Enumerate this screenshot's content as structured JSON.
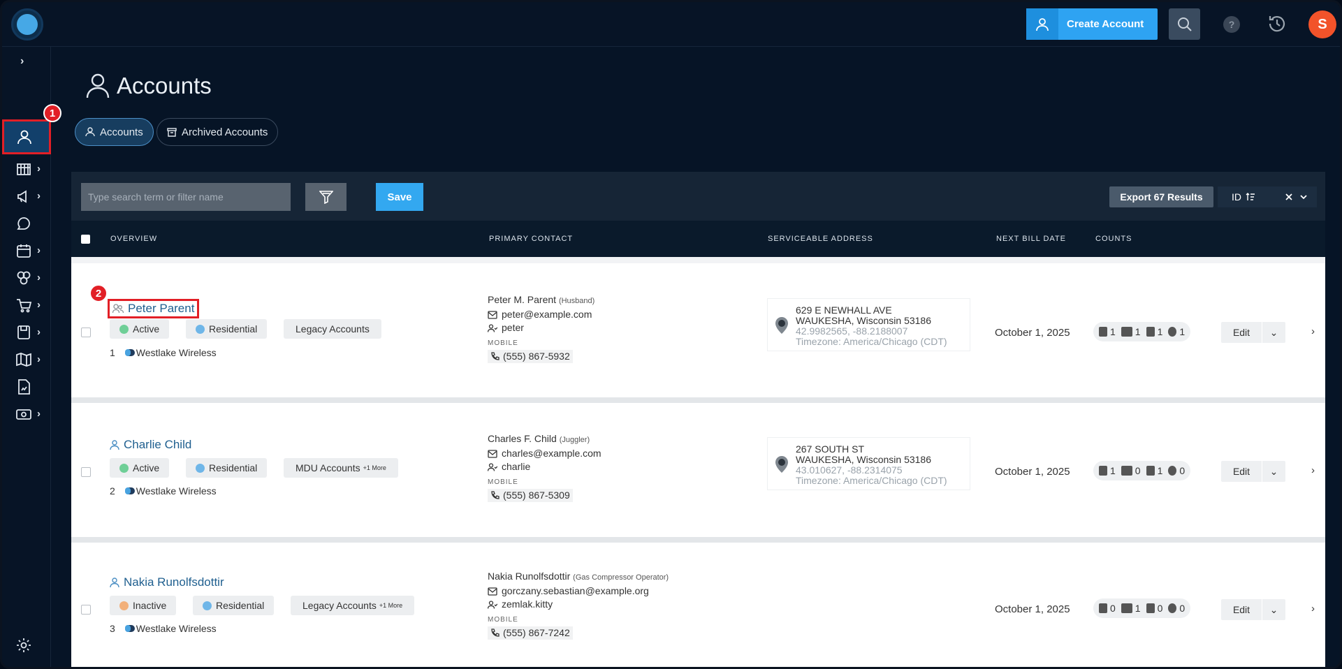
{
  "header": {
    "create_label": "Create Account",
    "help_label": "?",
    "avatar_initial": "S"
  },
  "annotations": {
    "badge1": "1",
    "badge2": "2"
  },
  "page": {
    "title": "Accounts"
  },
  "tabs": [
    {
      "label": "Accounts",
      "active": true
    },
    {
      "label": "Archived Accounts",
      "active": false
    }
  ],
  "toolbar": {
    "search_placeholder": "Type search term or filter name",
    "save_label": "Save",
    "export_label": "Export 67 Results",
    "sort_label": "ID"
  },
  "table": {
    "headers": [
      "OVERVIEW",
      "PRIMARY CONTACT",
      "SERVICEABLE ADDRESS",
      "NEXT BILL DATE",
      "COUNTS"
    ],
    "rows": [
      {
        "name": "Peter Parent",
        "status": "Active",
        "status_color": "#6fcf97",
        "type": "Residential",
        "type_color": "#6fb6e8",
        "group": "Legacy Accounts",
        "group_more": "",
        "index": "1",
        "provider": "Westlake Wireless",
        "contact_name": "Peter M. Parent",
        "contact_role": "(Husband)",
        "email": "peter@example.com",
        "username": "peter",
        "mobile_label": "MOBILE",
        "phone": "(555) 867-5932",
        "addr1": "629 E NEWHALL AVE",
        "addr2": "WAUKESHA, Wisconsin 53186",
        "coords": "42.9982565, -88.2188007",
        "tz": "Timezone: America/Chicago (CDT)",
        "bill_date": "October 1, 2025",
        "counts": [
          "1",
          "1",
          "1",
          "1"
        ],
        "edit_label": "Edit"
      },
      {
        "name": "Charlie Child",
        "status": "Active",
        "status_color": "#6fcf97",
        "type": "Residential",
        "type_color": "#6fb6e8",
        "group": "MDU Accounts",
        "group_more": "+1 More",
        "index": "2",
        "provider": "Westlake Wireless",
        "contact_name": "Charles F. Child",
        "contact_role": "(Juggler)",
        "email": "charles@example.com",
        "username": "charlie",
        "mobile_label": "MOBILE",
        "phone": "(555) 867-5309",
        "addr1": "267 SOUTH ST",
        "addr2": "WAUKESHA, Wisconsin 53186",
        "coords": "43.010627, -88.2314075",
        "tz": "Timezone: America/Chicago (CDT)",
        "bill_date": "October 1, 2025",
        "counts": [
          "1",
          "0",
          "1",
          "0"
        ],
        "edit_label": "Edit"
      },
      {
        "name": "Nakia Runolfsdottir",
        "status": "Inactive",
        "status_color": "#f2b07a",
        "type": "Residential",
        "type_color": "#6fb6e8",
        "group": "Legacy Accounts",
        "group_more": "+1 More",
        "index": "3",
        "provider": "Westlake Wireless",
        "contact_name": "Nakia Runolfsdottir",
        "contact_role": "(Gas Compressor Operator)",
        "email": "gorczany.sebastian@example.org",
        "username": "zemlak.kitty",
        "mobile_label": "MOBILE",
        "phone": "(555) 867-7242",
        "bill_date": "October 1, 2025",
        "counts": [
          "0",
          "1",
          "0",
          "0"
        ],
        "edit_label": "Edit"
      }
    ]
  }
}
